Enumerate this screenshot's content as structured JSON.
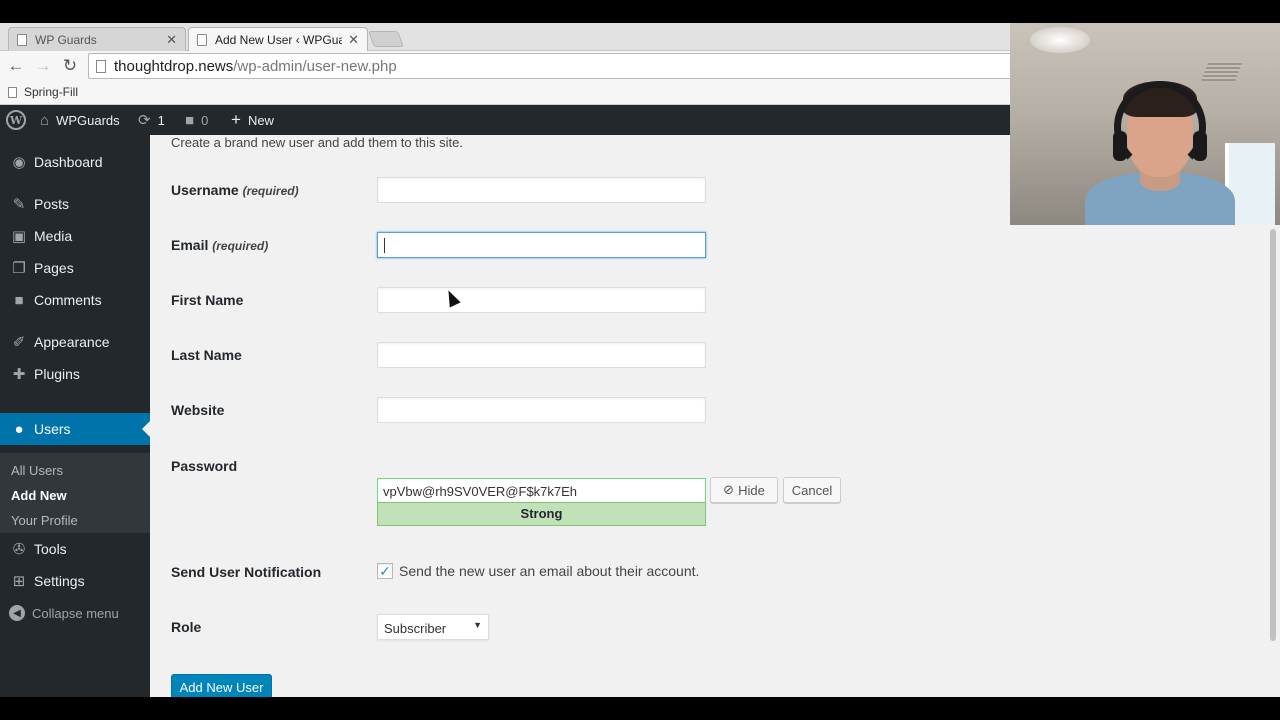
{
  "browser": {
    "tabs": [
      {
        "label": "WP Guards",
        "active": false
      },
      {
        "label": "Add New User ‹ WPGuard",
        "active": true
      }
    ],
    "url_domain": "thoughtdrop.news",
    "url_path": "/wp-admin/user-new.php",
    "bookmarks": [
      "Spring-Fill"
    ]
  },
  "adminbar": {
    "site_name": "WPGuards",
    "updates_count": "1",
    "comments_count": "0",
    "new_label": "New"
  },
  "sidebar": {
    "items": [
      {
        "label": "Dashboard",
        "icon": "dashboard-icon"
      },
      {
        "label": "Posts",
        "icon": "pin-icon"
      },
      {
        "label": "Media",
        "icon": "media-icon"
      },
      {
        "label": "Pages",
        "icon": "pages-icon"
      },
      {
        "label": "Comments",
        "icon": "comments-icon"
      },
      {
        "label": "Appearance",
        "icon": "brush-icon"
      },
      {
        "label": "Plugins",
        "icon": "plug-icon"
      },
      {
        "label": "Users",
        "icon": "user-icon"
      },
      {
        "label": "Tools",
        "icon": "wrench-icon"
      },
      {
        "label": "Settings",
        "icon": "settings-icon"
      }
    ],
    "users_submenu": [
      "All Users",
      "Add New",
      "Your Profile"
    ],
    "collapse_label": "Collapse menu"
  },
  "form": {
    "intro": "Create a brand new user and add them to this site.",
    "required_note": "(required)",
    "username_label": "Username",
    "email_label": "Email",
    "first_name_label": "First Name",
    "last_name_label": "Last Name",
    "website_label": "Website",
    "password_label": "Password",
    "password_value": "vpVbw@rh9SV0VER@F$k7k7Eh",
    "password_strength": "Strong",
    "hide_label": "Hide",
    "cancel_label": "Cancel",
    "notification_label": "Send User Notification",
    "notification_text": "Send the new user an email about their account.",
    "role_label": "Role",
    "role_value": "Subscriber",
    "submit_label": "Add New User"
  },
  "colors": {
    "admin_dark": "#23282d",
    "accent_blue": "#0073aa",
    "strong_green": "#c1e1b9"
  }
}
